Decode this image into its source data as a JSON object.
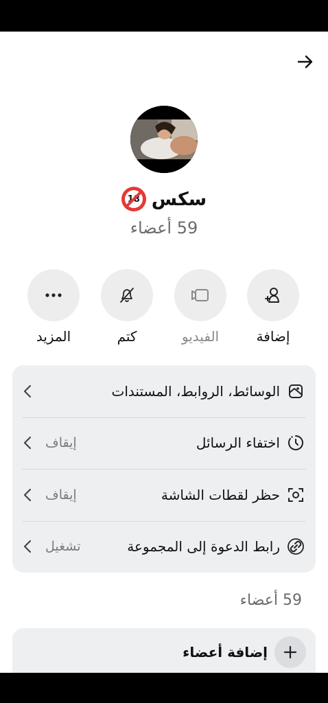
{
  "group": {
    "name": "سكس",
    "badge_text": "18",
    "member_count": "59 أعضاء"
  },
  "actions": [
    {
      "label": "إضافة",
      "icon": "add-user-icon",
      "muted": false
    },
    {
      "label": "الفيديو",
      "icon": "video-icon",
      "muted": true
    },
    {
      "label": "كتم",
      "icon": "bell-off-icon",
      "muted": false
    },
    {
      "label": "المزيد",
      "icon": "more-icon",
      "muted": false
    }
  ],
  "settings": {
    "media": {
      "label": "الوسائط، الروابط، المستندات",
      "value": ""
    },
    "disappearing": {
      "label": "اختفاء الرسائل",
      "value": "إيقاف"
    },
    "screenshot": {
      "label": "حظر لقطات الشاشة",
      "value": "إيقاف"
    },
    "invite": {
      "label": "رابط الدعوة إلى المجموعة",
      "value": "تشغيل"
    }
  },
  "members": {
    "heading": "59 أعضاء",
    "add_label": "إضافة أعضاء"
  },
  "colors": {
    "card_bg": "#eeeff1",
    "circle_bg": "#ededed",
    "badge_red": "#e53935"
  }
}
